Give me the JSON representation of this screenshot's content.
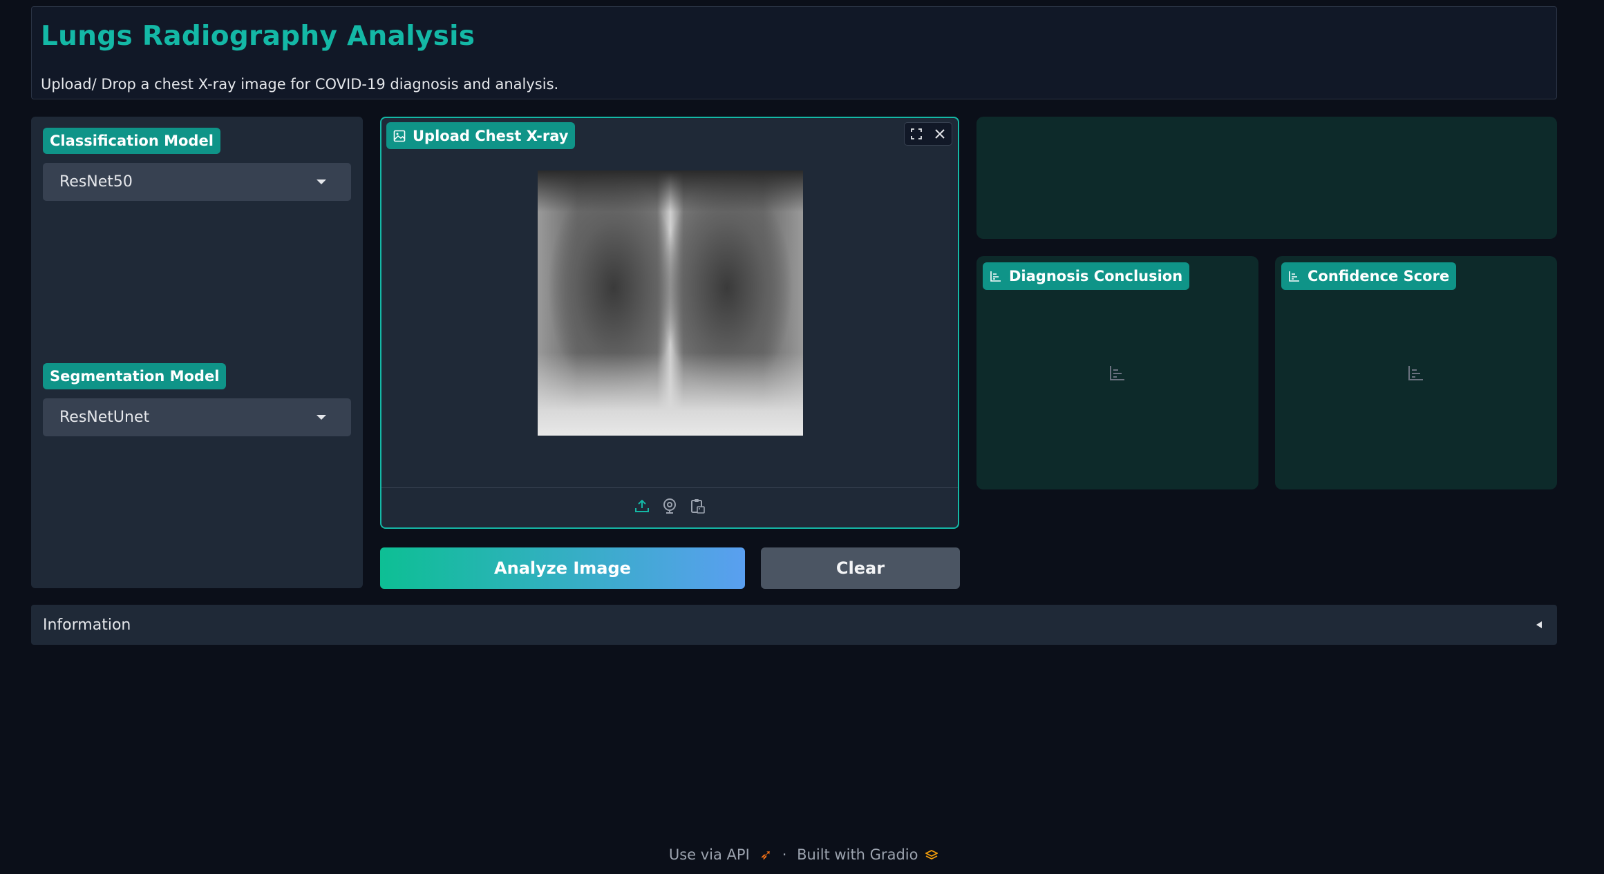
{
  "header": {
    "title": "Lungs Radiography Analysis",
    "subtitle": "Upload/ Drop a chest X-ray image for COVID-19 diagnosis and analysis."
  },
  "sidebar": {
    "classification_label": "Classification Model",
    "classification_value": "ResNet50",
    "segmentation_label": "Segmentation Model",
    "segmentation_value": "ResNetUnet"
  },
  "upload": {
    "label": "Upload Chest X-ray",
    "image_icon": "image-icon",
    "fullscreen_icon": "fullscreen-icon",
    "close_icon": "close-icon",
    "source_icons": [
      "upload-icon",
      "webcam-icon",
      "clipboard-icon"
    ]
  },
  "buttons": {
    "analyze": "Analyze Image",
    "clear": "Clear"
  },
  "outputs": {
    "diagnosis_label": "Diagnosis Conclusion",
    "confidence_label": "Confidence Score"
  },
  "info": {
    "label": "Information"
  },
  "footer": {
    "api": "Use via API",
    "separator": "·",
    "built": "Built with Gradio"
  },
  "colors": {
    "accent": "#14b8a6",
    "badge": "#0f9488",
    "background": "#0b0f19"
  }
}
